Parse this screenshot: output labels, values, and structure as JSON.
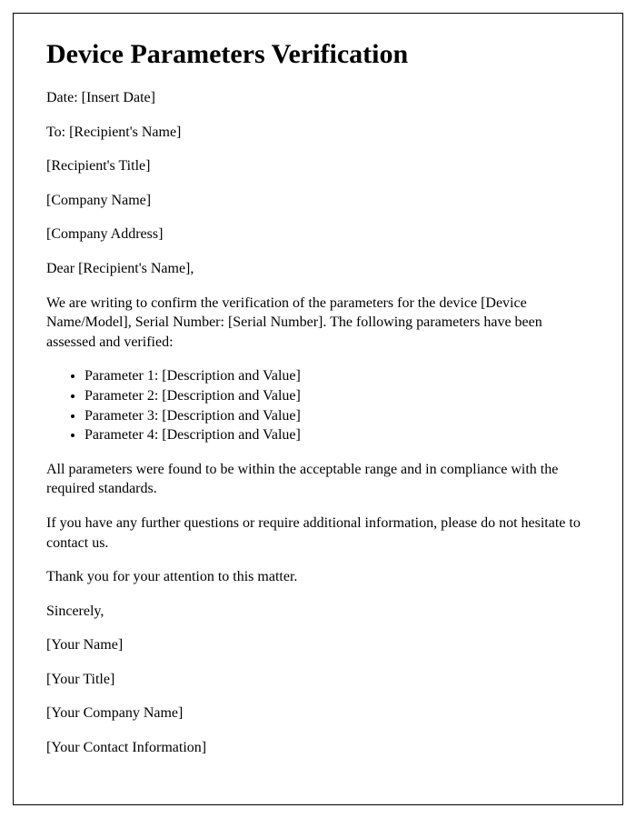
{
  "title": "Device Parameters Verification",
  "date_line": "Date: [Insert Date]",
  "to_line": "To: [Recipient's Name]",
  "recipient_title": "[Recipient's Title]",
  "company_name": "[Company Name]",
  "company_address": "[Company Address]",
  "salutation": "Dear [Recipient's Name],",
  "intro_paragraph": "We are writing to confirm the verification of the parameters for the device [Device Name/Model], Serial Number: [Serial Number]. The following parameters have been assessed and verified:",
  "parameters": [
    "Parameter 1: [Description and Value]",
    "Parameter 2: [Description and Value]",
    "Parameter 3: [Description and Value]",
    "Parameter 4: [Description and Value]"
  ],
  "compliance_paragraph": "All parameters were found to be within the acceptable range and in compliance with the required standards.",
  "contact_paragraph": "If you have any further questions or require additional information, please do not hesitate to contact us.",
  "thank_you": "Thank you for your attention to this matter.",
  "closing": "Sincerely,",
  "signer_name": "[Your Name]",
  "signer_title": "[Your Title]",
  "signer_company": "[Your Company Name]",
  "signer_contact": "[Your Contact Information]"
}
